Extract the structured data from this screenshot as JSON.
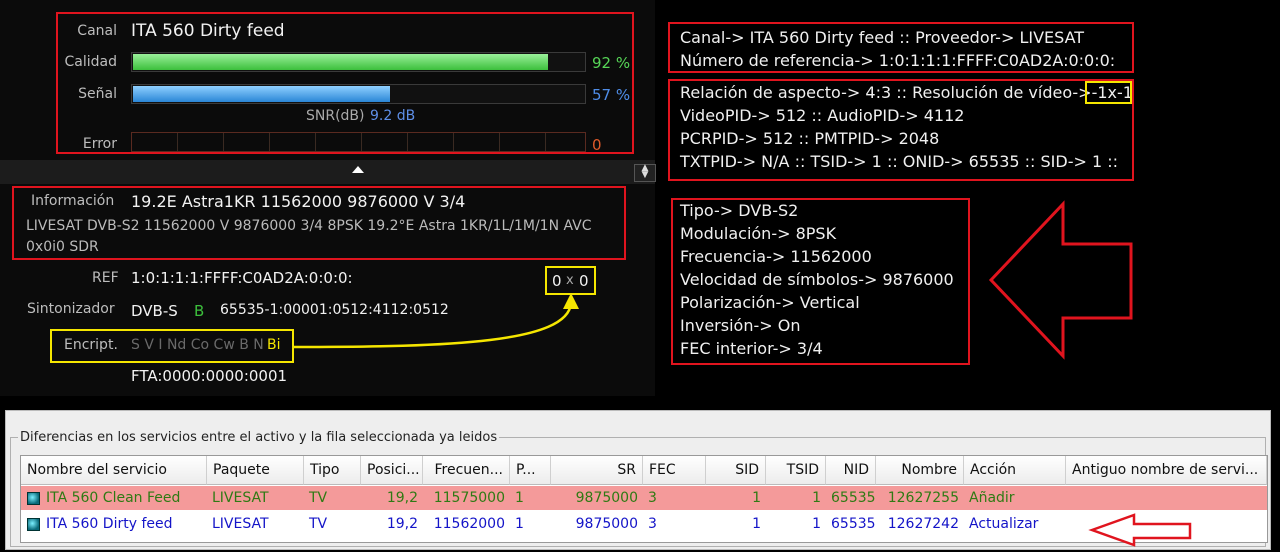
{
  "signal": {
    "canal_label": "Canal",
    "canal_value": "ITA 560 Dirty feed",
    "calidad_label": "Calidad",
    "calidad_pct": 0.92,
    "calidad_text": "92 %",
    "senal_label": "Señal",
    "senal_pct": 0.57,
    "senal_text": "57 %",
    "snr_label": "SNR(dB)",
    "snr_value": "9.2 dB",
    "error_label": "Error",
    "error_value": "0"
  },
  "info": {
    "informacion_label": "Información",
    "informacion_value": "19.2E Astra1KR 11562000 9876000 V 3/4",
    "detail_line1": "LIVESAT  DVB-S2  11562000  V  9876000  3/4  8PSK  19.2°E  Astra 1KR/1L/1M/1N  AVC",
    "detail_line2": "0x0i0  SDR",
    "ref_label": "REF",
    "ref_value": "1:0:1:1:1:FFFF:C0AD2A:0:0:0:",
    "res_w": "0",
    "res_x": "x",
    "res_h": "0",
    "sint_label": "Sintonizador",
    "sint_value": "DVB-S",
    "sint_b": "B",
    "sint_pids": "65535-1:00001:0512:4112:0512",
    "encript_label": "Encript.",
    "encript_flags": "S V I Nd Co Cw B N",
    "encript_active": "Bi",
    "fta": "FTA:0000:0000:0001"
  },
  "annotations": {
    "box1": [
      "Canal-> ITA 560 Dirty feed :: Proveedor-> LIVESAT",
      "Número de referencia-> 1:0:1:1:1:FFFF:C0AD2A:0:0:0:"
    ],
    "box2_line1": "Relación de aspecto-> 4:3 :: Resolución de vídeo->",
    "box2_res": "-1x-1",
    "box2": [
      "VideoPID-> 512 :: AudioPID-> 4112",
      "PCRPID-> 512 :: PMTPID-> 2048",
      "TXTPID-> N/A :: TSID-> 1 :: ONID-> 65535 :: SID-> 1 ::"
    ],
    "box3": [
      "Tipo-> DVB-S2",
      "Modulación-> 8PSK",
      "Frecuencia-> 11562000",
      "Velocidad de símbolos-> 9876000",
      "Polarización-> Vertical",
      "Inversión-> On",
      "FEC interior-> 3/4"
    ]
  },
  "grid": {
    "legend": "Diferencias en los servicios entre el activo y la fila seleccionada ya leidos",
    "columns": [
      "Nombre del servicio",
      "Paquete",
      "Tipo",
      "Posici...",
      "Frecuen...",
      "P...",
      "SR",
      "FEC",
      "SID",
      "TSID",
      "NID",
      "Nombre",
      "Acción",
      "Antiguo nombre de servi..."
    ],
    "rows": [
      [
        "ITA 560 Clean Feed",
        "LIVESAT",
        "TV",
        "19,2",
        "11575000",
        "1",
        "9875000",
        "3",
        "1",
        "1",
        "65535",
        "12627255",
        "Añadir",
        ""
      ],
      [
        "ITA 560 Dirty feed",
        "LIVESAT",
        "TV",
        "19,2",
        "11562000",
        "1",
        "9875000",
        "3",
        "1",
        "1",
        "65535",
        "12627242",
        "Actualizar",
        ""
      ]
    ]
  },
  "colors": {
    "red_annotation": "#e0141e",
    "yellow_annotation": "#f5e600",
    "calidad_bar": "#57d657",
    "senal_bar": "#3aa0e8",
    "row_added_bg": "#f49a9a",
    "row_added_text": "#2f7a14",
    "row_updated_text": "#1414c8"
  }
}
